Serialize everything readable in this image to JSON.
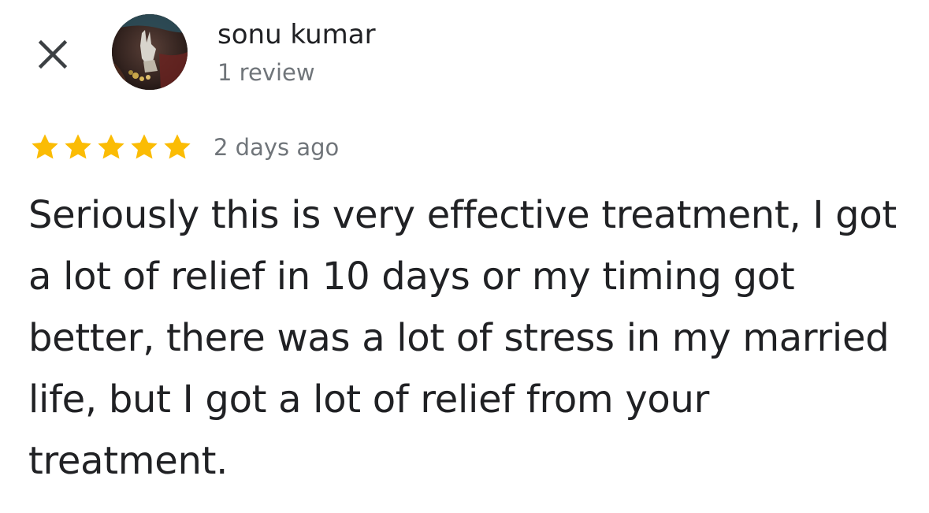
{
  "header": {
    "close_icon": "close-icon",
    "user_name": "sonu kumar",
    "review_count": "1 review"
  },
  "review": {
    "rating": 5,
    "max_rating": 5,
    "star_color": "#FBBC04",
    "time_ago": "2 days ago",
    "text": "Seriously this is very effective treatment, I got a lot of relief in 10 days or my timing got better, there was a lot of stress in my married life, but I got a lot of relief from your treatment."
  }
}
